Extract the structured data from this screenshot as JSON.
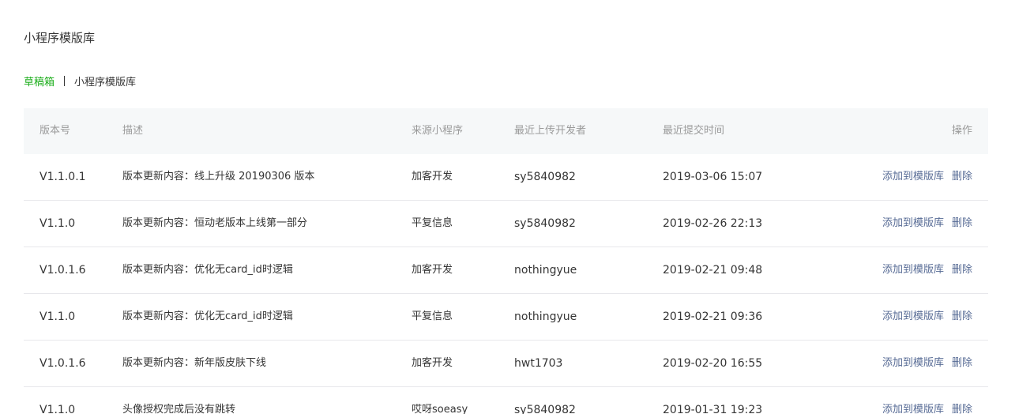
{
  "page": {
    "title": "小程序模版库"
  },
  "breadcrumb": {
    "link": "草稿箱",
    "current": "小程序模版库"
  },
  "table": {
    "headers": {
      "version": "版本号",
      "description": "描述",
      "source": "来源小程序",
      "developer": "最近上传开发者",
      "time": "最近提交时间",
      "ops": "操作"
    },
    "rows": [
      {
        "version": "V1.1.0.1",
        "description": "版本更新内容：线上升级 20190306 版本",
        "source": "加客开发",
        "developer": "sy5840982",
        "time": "2019-03-06 15:07",
        "add": "添加到模版库",
        "delete": "删除"
      },
      {
        "version": "V1.1.0",
        "description": "版本更新内容：恒动老版本上线第一部分",
        "source": "平复信息",
        "developer": "sy5840982",
        "time": "2019-02-26 22:13",
        "add": "添加到模版库",
        "delete": "删除"
      },
      {
        "version": "V1.0.1.6",
        "description": "版本更新内容：优化无card_id时逻辑",
        "source": "加客开发",
        "developer": "nothingyue",
        "time": "2019-02-21 09:48",
        "add": "添加到模版库",
        "delete": "删除"
      },
      {
        "version": "V1.1.0",
        "description": "版本更新内容：优化无card_id时逻辑",
        "source": "平复信息",
        "developer": "nothingyue",
        "time": "2019-02-21 09:36",
        "add": "添加到模版库",
        "delete": "删除"
      },
      {
        "version": "V1.0.1.6",
        "description": "版本更新内容：新年版皮肤下线",
        "source": "加客开发",
        "developer": "hwt1703",
        "time": "2019-02-20 16:55",
        "add": "添加到模版库",
        "delete": "删除"
      },
      {
        "version": "V1.1.0",
        "description": "头像授权完成后没有跳转",
        "source": "哎呀soeasy",
        "developer": "sy5840982",
        "time": "2019-01-31 19:23",
        "add": "添加到模版库",
        "delete": "删除"
      }
    ]
  },
  "colors": {
    "accent_green": "#1aad19",
    "link_blue": "#576b95",
    "header_bg": "#f6f8f9"
  }
}
